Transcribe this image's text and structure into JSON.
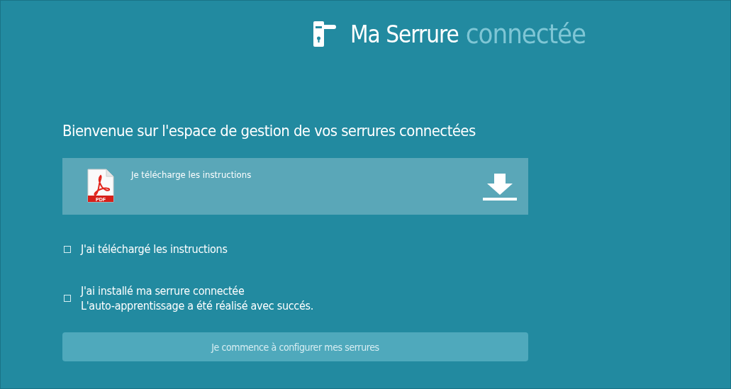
{
  "logo": {
    "name": "Ma Serrure",
    "suffix": "connectée"
  },
  "heading": "Bienvenue sur l'espace de gestion de vos serrures connectées",
  "download": {
    "label": "Je télécharge les instructions",
    "file_badge": "PDF"
  },
  "checklist": [
    {
      "lines": [
        "J'ai téléchargé les instructions"
      ],
      "checked": false
    },
    {
      "lines": [
        "J'ai installé ma serrure connectée",
        "L'auto-apprentissage a été réalisé avec succés."
      ],
      "checked": false
    }
  ],
  "start_button": {
    "label": "Je commence à configurer mes serrures",
    "disabled": true
  }
}
